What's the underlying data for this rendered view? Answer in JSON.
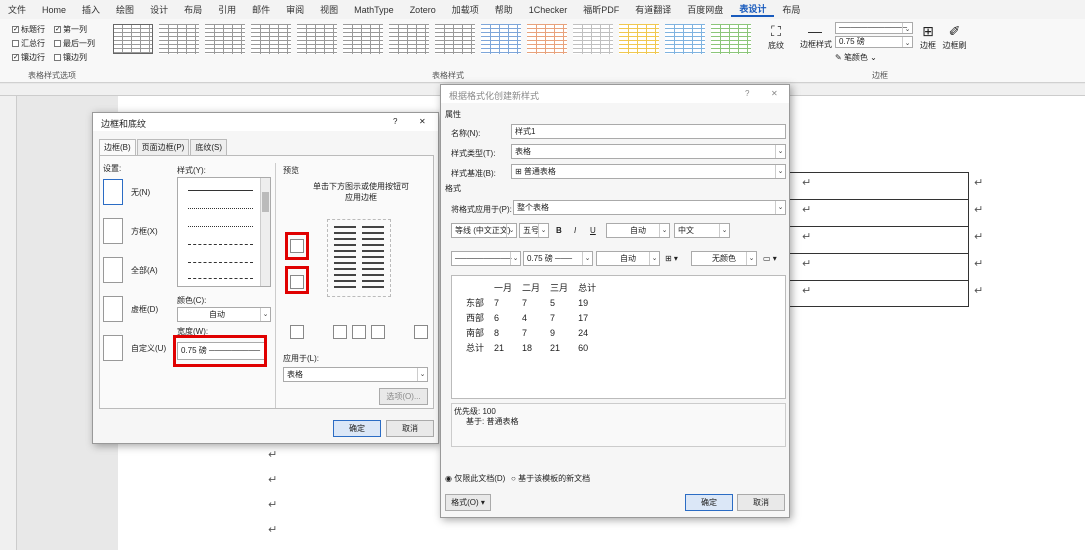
{
  "menu": [
    "文件",
    "Home",
    "插入",
    "绘图",
    "设计",
    "布局",
    "引用",
    "邮件",
    "审阅",
    "视图",
    "MathType",
    "Zotero",
    "加载项",
    "帮助",
    "1Checker",
    "福昕PDF",
    "有道翻译",
    "百度网盘",
    "表设计",
    "布局"
  ],
  "ribbon": {
    "options": {
      "header_row": "标题行",
      "first_col": "第一列",
      "total_row": "汇总行",
      "last_col": "最后一列",
      "banded_rows": "镶边行",
      "banded_cols": "镶边列",
      "group": "表格样式选项"
    },
    "styles_group": "表格样式",
    "shading": "底纹",
    "border_styles": "边框样式",
    "pen_weight": "0.75 磅",
    "pen_color": "笔颜色",
    "borders": "边框",
    "painter": "边框刷",
    "borders_group": "边框",
    "style_colors": [
      "#9a9a9a",
      "#9a9a9a",
      "#9a9a9a",
      "#9a9a9a",
      "#9a9a9a",
      "#9a9a9a",
      "#9a9a9a",
      "#9a9a9a",
      "#7ea6d9",
      "#e8a27c",
      "#c0c0c0",
      "#f0c850",
      "#7fb3e0",
      "#8cc67a"
    ]
  },
  "borders_dialog": {
    "title": "边框和底纹",
    "help": "?",
    "close": "✕",
    "tabs": [
      "边框(B)",
      "页面边框(P)",
      "底纹(S)"
    ],
    "setting_label": "设置:",
    "settings": [
      "无(N)",
      "方框(X)",
      "全部(A)",
      "虚框(D)",
      "自定义(U)"
    ],
    "style_label": "样式(Y):",
    "color_label": "颜色(C):",
    "color_value": "自动",
    "width_label": "宽度(W):",
    "width_value": "0.75 磅",
    "preview_label": "预览",
    "preview_hint": "单击下方图示或使用按钮可应用边框",
    "apply_label": "应用于(L):",
    "apply_value": "表格",
    "options_btn": "选项(O)...",
    "ok": "确定",
    "cancel": "取消"
  },
  "style_dialog": {
    "title": "根据格式化创建新样式",
    "help": "?",
    "close": "✕",
    "props_label": "属性",
    "name_label": "名称(N):",
    "name_value": "样式1",
    "type_label": "样式类型(T):",
    "type_value": "表格",
    "based_label": "样式基准(B):",
    "based_value": "⊞ 普通表格",
    "format_label": "格式",
    "apply_label": "将格式应用于(P):",
    "apply_value": "整个表格",
    "font": "等线 (中文正文)",
    "size": "五号",
    "bold": "B",
    "italic": "I",
    "underline": "U",
    "color": "自动",
    "lang": "中文",
    "line_weight": "0.75 磅",
    "line_color": "自动",
    "fill": "无颜色",
    "preview": {
      "headers": [
        "",
        "一月",
        "二月",
        "三月",
        "总计"
      ],
      "rows": [
        [
          "东部",
          "7",
          "7",
          "5",
          "19"
        ],
        [
          "西部",
          "6",
          "4",
          "7",
          "17"
        ],
        [
          "南部",
          "8",
          "7",
          "9",
          "24"
        ],
        [
          "总计",
          "21",
          "18",
          "21",
          "60"
        ]
      ]
    },
    "priority": "优先级: 100",
    "based_on": "基于: 普通表格",
    "radio1": "仅限此文档(D)",
    "radio2": "基于该模板的新文档",
    "format_btn": "格式(O) ▾",
    "ok": "确定",
    "cancel": "取消"
  }
}
